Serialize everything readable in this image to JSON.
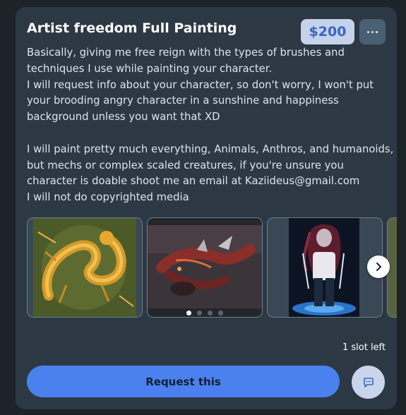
{
  "commission": {
    "title": "Artist freedom Full Painting",
    "price": "$200",
    "description_lines": [
      "Basically, giving me free reign with the types of brushes and",
      "techniques I use while painting your character.",
      "I will request info about your character, so don't worry, I won't put",
      "your brooding angry character in a sunshine and happiness",
      "background unless you want that XD",
      "",
      "I will paint pretty much everything, Animals, Anthros, and humanoids,",
      "but mechs or complex scaled creatures, if you're unsure you",
      "character is doable shoot me an email at Kaziideus@gmail.com",
      "I will not do copyrighted media"
    ],
    "slots_left": "1 slot left",
    "request_label": "Request this"
  },
  "gallery": {
    "images": [
      {
        "subject": "golden-dragon-painting"
      },
      {
        "subject": "red-creature-painting"
      },
      {
        "subject": "dark-haired-figure-painting"
      },
      {
        "subject": "partial-painting"
      }
    ],
    "active_index": 0,
    "dot_count": 4
  },
  "icons": {
    "more": "more-icon",
    "next": "chevron-right-icon",
    "chat": "chat-icon"
  },
  "colors": {
    "page_bg": "#1c2329",
    "card_bg": "#2c3944",
    "price_bg": "#c4d2ea",
    "price_text": "#3c66be",
    "accent": "#4a81ee"
  }
}
